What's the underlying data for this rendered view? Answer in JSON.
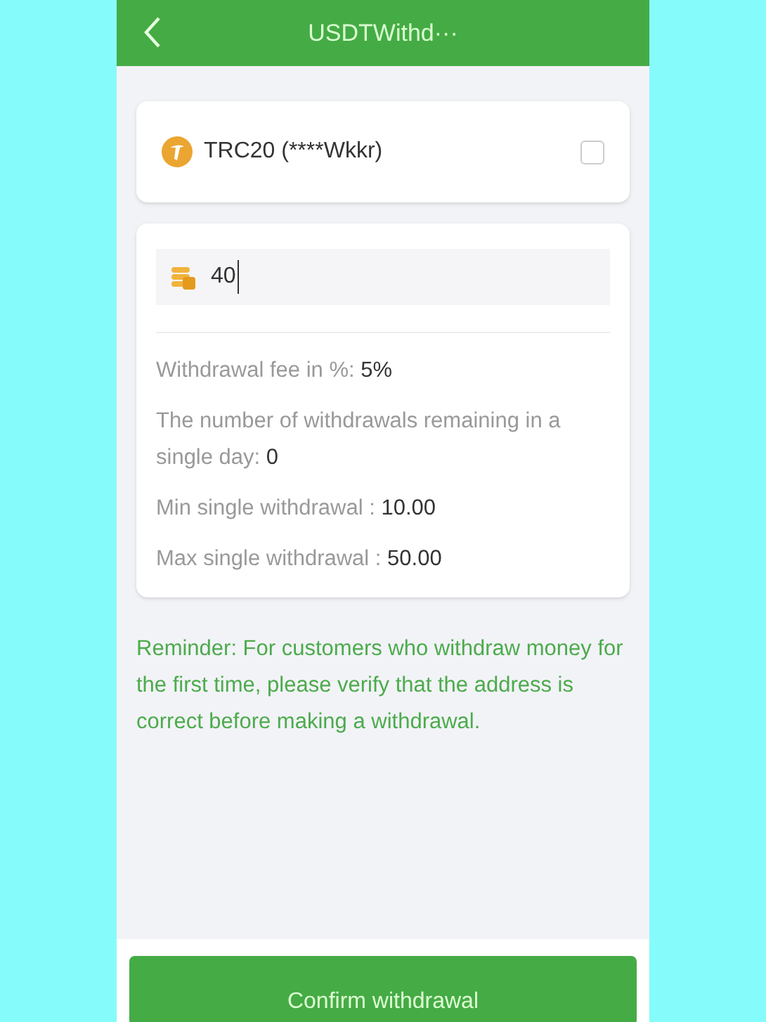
{
  "header": {
    "title": "USDTWithd···"
  },
  "address": {
    "label": "TRC20 (****Wkkr)",
    "checked": false
  },
  "amount": {
    "value": "40"
  },
  "info": [
    {
      "label": "Withdrawal fee in %: ",
      "value": "5%"
    },
    {
      "label": "The number of withdrawals remaining in a single day: ",
      "value": "0"
    },
    {
      "label": "Min single withdrawal : ",
      "value": "10.00"
    },
    {
      "label": "Max single withdrawal : ",
      "value": "50.00"
    }
  ],
  "reminder": "Reminder: For customers who withdraw money for the first time, please verify that the address is correct before making a withdrawal.",
  "confirm_button": "Confirm withdrawal"
}
